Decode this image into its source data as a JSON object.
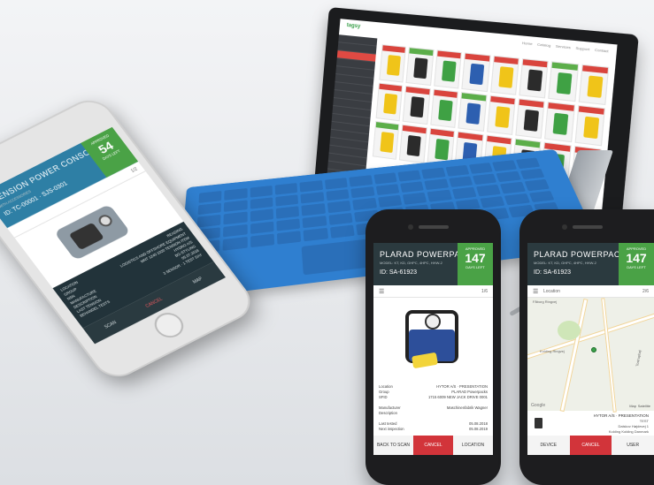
{
  "tablet": {
    "logo": "tagsy",
    "nav": [
      "Home",
      "Catalog",
      "Services",
      "Support",
      "Contact"
    ],
    "sidebar_rows": 18,
    "cards": 24
  },
  "phone_left": {
    "title": "TENSION POWER CONSOLE",
    "subtitle": "WITH ACCESSORIES",
    "id": "ID: TC-00001 · SJS-0301",
    "status_label": "APPROVED",
    "status_value": "54",
    "status_unit": "DAYS LEFT",
    "counter": "1/2",
    "details": [
      [
        "LOCATION",
        "READING"
      ],
      [
        "GROUP",
        "LOGISTICS AND OFFSHORE EQUIPMENT"
      ],
      [
        "NSN",
        "MNT 1240 1020 TENSION ITEM"
      ],
      [
        "MANUFACTURE",
        "HYDRO A/S"
      ],
      [
        "DESCRIPTION",
        "BG-STYLING"
      ],
      [
        "LAST TENSION",
        "05.07.2018"
      ],
      [
        "BEHANDEL TESTS",
        "3 SENSOR · 1 TEST DAY"
      ]
    ],
    "footer": [
      "SCAN",
      "CANCEL",
      "MAP"
    ]
  },
  "phone_mid": {
    "title": "PLARAD POWERPACKS",
    "model": "MODEL: KT, KD, GHPC, 4HPC, HHW-2",
    "id": "ID: SA-61923",
    "status_label": "APPROVED",
    "status_value": "147",
    "status_unit": "DAYS LEFT",
    "counter": "1/6",
    "details": [
      [
        "Location",
        "HYTOR A/S · PRESENTATION"
      ],
      [
        "Group",
        "PLARAD Powerpacks"
      ],
      [
        "SFID",
        "1715 6009 NEW JACK DRIVE 0001"
      ],
      [
        "",
        ""
      ],
      [
        "Manufacturer",
        "Maschinenfabrik Wagner"
      ],
      [
        "Description",
        ""
      ],
      [
        "",
        ""
      ],
      [
        "Last tested",
        "05.08.2018"
      ],
      [
        "Next inspection",
        "05.08.2019"
      ]
    ],
    "footer": [
      "BACK TO SCAN",
      "CANCEL",
      "LOCATION"
    ]
  },
  "phone_right": {
    "title": "PLARAD POWERPACKS",
    "model": "MODEL: KT, KD, GHPC, 4HPC, HHW-2",
    "id": "ID: SA-61923",
    "status_label": "APPROVED",
    "status_value": "147",
    "status_unit": "DAYS LEFT",
    "sub_label": "Location",
    "counter": "2/6",
    "map_labels": [
      "Map",
      "Satellite"
    ],
    "street_labels": [
      "Fåborg Ringvej",
      "Kolding Ringvej",
      "Tostruphøj"
    ],
    "google": "Google",
    "address_title": "HYTOR A/S · PRESENTATION",
    "address_sub": "TEST",
    "address_lines": [
      "Dalskov Højdevej 1",
      "Kolding Kolding Danmark"
    ],
    "footer": [
      "DEVICE",
      "CANCEL",
      "USER"
    ]
  }
}
